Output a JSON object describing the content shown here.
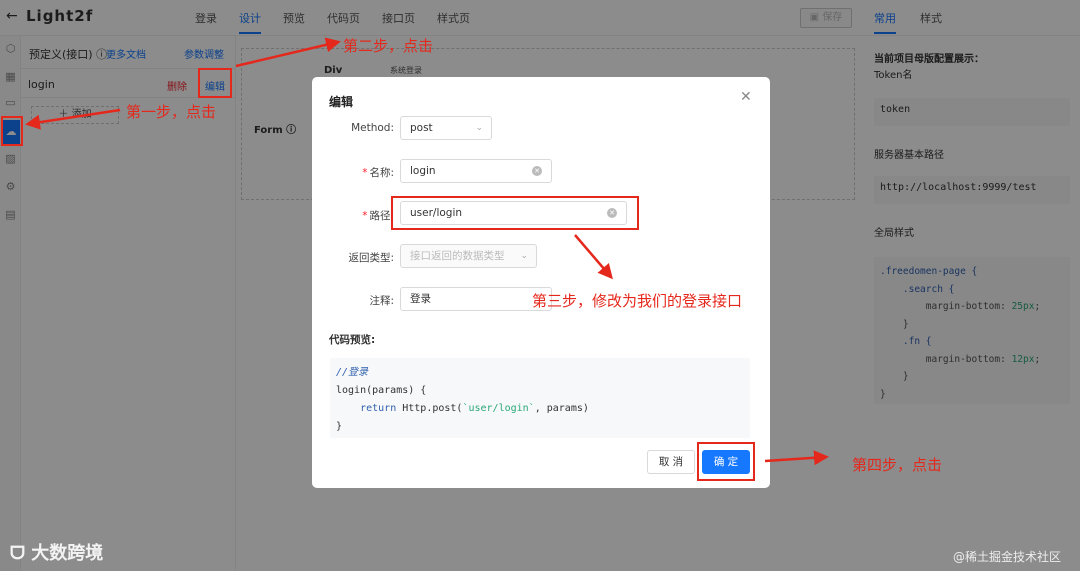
{
  "app": {
    "title": "Light2f",
    "back_icon": "arrow-left-icon"
  },
  "nav_tabs": [
    "登录",
    "设计",
    "预览",
    "代码页",
    "接口页",
    "样式页"
  ],
  "toolbar": {
    "save_label": "保存"
  },
  "right_tabs": [
    "常用",
    "样式"
  ],
  "left_panel": {
    "title": "预定义(接口)",
    "doc_link": "更多文档",
    "param_link": "参数调整",
    "item": {
      "name": "login",
      "delete_label": "删除",
      "edit_label": "编辑"
    },
    "add_label": "添加"
  },
  "canvas": {
    "div_label": "Div",
    "form_label": "Form",
    "system_text": "系统登录"
  },
  "right_panel": {
    "master_title": "当前项目母版配置展示：",
    "token_label": "Token名",
    "token_value": "token",
    "base_path_label": "服务器基本路径",
    "base_path_value": "http://localhost:9999/test",
    "global_style_label": "全局样式",
    "css": {
      "l1": ".freedomen-page {",
      "l2": "    .search {",
      "l3a": "        margin-bottom: ",
      "l3b": "25px",
      "l4": "    }",
      "l5": "    .fn {",
      "l6a": "        margin-bottom: ",
      "l6b": "12px",
      "l7": "    }",
      "l8": "}"
    }
  },
  "modal": {
    "title": "编辑",
    "close_icon": "close-icon",
    "method_label": "Method:",
    "method_value": "post",
    "name_label": "名称:",
    "name_value": "login",
    "path_label": "路径:",
    "path_value": "user/login",
    "return_label": "返回类型:",
    "return_placeholder": "接口返回的数据类型",
    "comment_label": "注释:",
    "comment_value": "登录",
    "preview_title": "代码预览:",
    "code": {
      "comment": "//登录",
      "l2": "login(params) {",
      "l3_kw": "return",
      "l3_a": " Http.post(",
      "l3_str": "`user/login`",
      "l3_b": ", params)",
      "l4": "}"
    },
    "cancel_label": "取 消",
    "ok_label": "确 定"
  },
  "annotations": {
    "step1": "第一步，点击",
    "step2": "第二步，点击",
    "step3": "第三步，修改为我们的登录接口",
    "step4": "第四步，点击"
  },
  "watermarks": {
    "left": "大数跨境",
    "right": "@稀土掘金技术社区"
  },
  "colors": {
    "accent": "#1677ff",
    "annotation": "#e5281c",
    "danger": "#f5222d"
  }
}
